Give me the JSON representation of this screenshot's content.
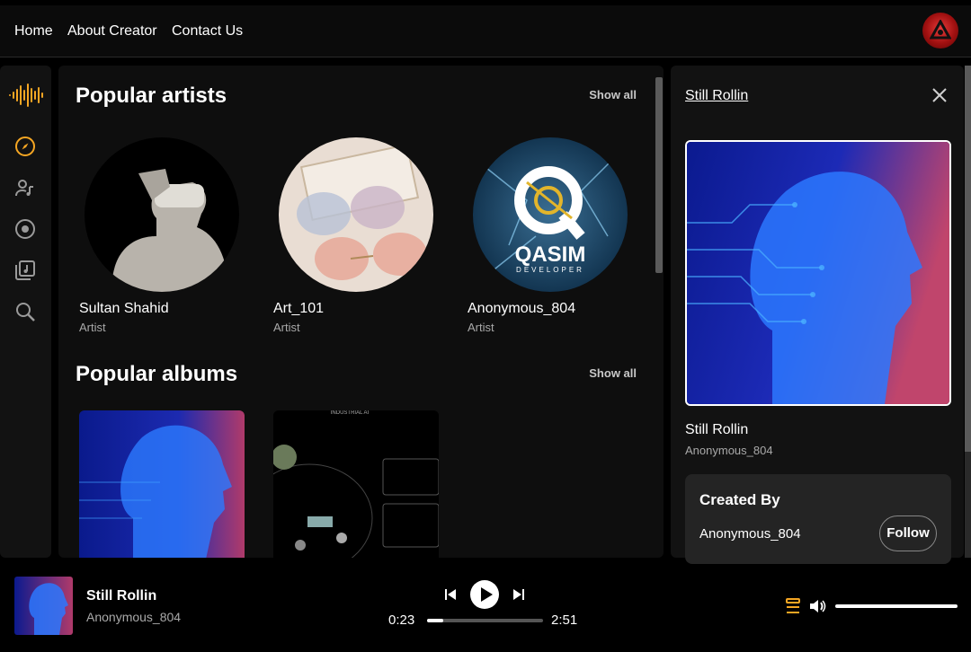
{
  "nav": {
    "home": "Home",
    "about": "About Creator",
    "contact": "Contact Us"
  },
  "main": {
    "popular_artists_title": "Popular artists",
    "popular_albums_title": "Popular albums",
    "show_all": "Show all",
    "artists": [
      {
        "name": "Sultan Shahid",
        "role": "Artist"
      },
      {
        "name": "Art_101",
        "role": "Artist"
      },
      {
        "name": "Anonymous_804",
        "role": "Artist"
      }
    ],
    "qasim_logo_text": "QASIM",
    "qasim_logo_sub": "DEVELOPER",
    "album2_heading": "INDUSTRIAL AI"
  },
  "panel": {
    "title": "Still Rollin",
    "track_name": "Still Rollin",
    "track_artist": "Anonymous_804",
    "created_by_label": "Created By",
    "creator_name": "Anonymous_804",
    "follow_label": "Follow"
  },
  "player": {
    "title": "Still Rollin",
    "artist": "Anonymous_804",
    "current_time": "0:23",
    "duration": "2:51",
    "progress_fraction": 0.14,
    "volume_fraction": 1.0
  },
  "colors": {
    "accent": "#f5a623",
    "background": "#000000",
    "panel": "#121212"
  }
}
